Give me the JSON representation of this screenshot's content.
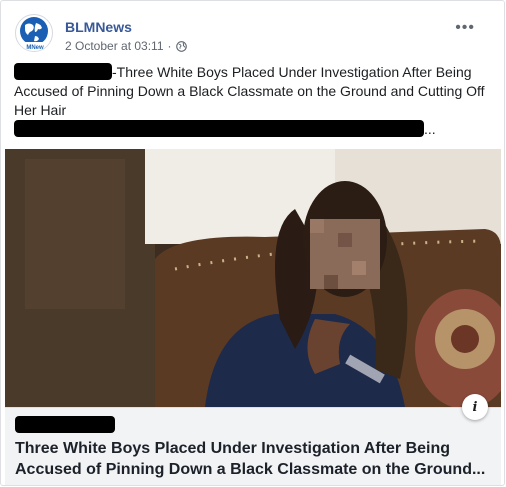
{
  "post": {
    "author": "BLMNews",
    "avatar_text": "MNew",
    "timestamp": "2 October at 03:11",
    "separator": "·",
    "privacy_icon": "globe-icon",
    "more_label": "•••",
    "text_part1": "-Three White Boys Placed Under Investigation After Being Accused of Pinning Down a Black Classmate on the Ground and Cutting Off Her Hair",
    "text_ellipsis": "..."
  },
  "link_preview": {
    "title": "Three White Boys Placed Under Investigation After Being Accused of Pinning Down a Black Classmate on the Ground...",
    "info_label": "i"
  },
  "colors": {
    "author": "#385898",
    "text": "#1c1e21",
    "meta": "#606770",
    "link_bg": "#f2f3f5"
  }
}
